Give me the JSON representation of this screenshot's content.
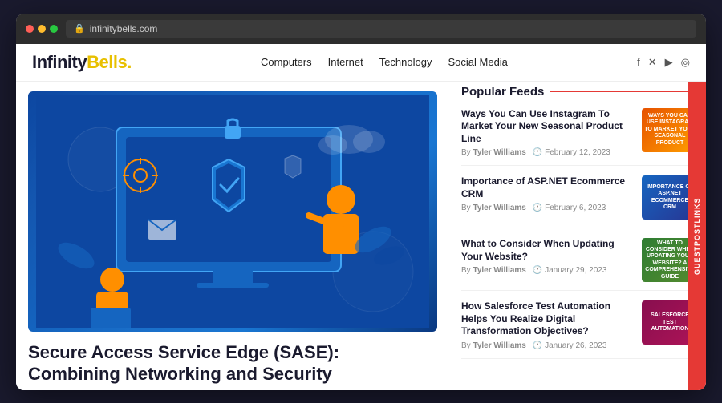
{
  "browser": {
    "url": "infinitybells.com",
    "dots": [
      "red",
      "yellow",
      "green"
    ]
  },
  "site": {
    "logo": {
      "part1": "Infinity",
      "part2": "Bells",
      "dot": "."
    },
    "nav": {
      "links": [
        "Computers",
        "Internet",
        "Technology",
        "Social Media"
      ]
    },
    "social_icons": [
      "f",
      "𝕏",
      "▶",
      "◉"
    ]
  },
  "sidebar": {
    "popular_feeds_title": "Popular Feeds",
    "feeds": [
      {
        "title": "Ways You Can Use Instagram To Market Your New Seasonal Product Line",
        "author": "Tyler Williams",
        "date": "February 12, 2023",
        "thumb_text": "WAYS YOU CAN USE INSTAGRAM TO MARKET YOUR SEASONAL PRODUCT"
      },
      {
        "title": "Importance of ASP.NET Ecommerce CRM",
        "author": "Tyler Williams",
        "date": "February 6, 2023",
        "thumb_text": "IMPORTANCE OF ASP.NET ECOMMERCE CRM"
      },
      {
        "title": "What to Consider When Updating Your Website?",
        "author": "Tyler Williams",
        "date": "January 29, 2023",
        "thumb_text": "WHAT TO CONSIDER WHEN UPDATING YOUR WEBSITE? A COMPREHENSIVE GUIDE"
      },
      {
        "title": "How Salesforce Test Automation Helps You Realize Digital Transformation Objectives?",
        "author": "Tyler Williams",
        "date": "January 26, 2023",
        "thumb_text": "SALESFORCE TEST AUTOMATION"
      }
    ]
  },
  "article": {
    "title_line1": "Secure Access Service Edge (SASE):",
    "title_line2": "Combining Networking and Security"
  },
  "guestpost": {
    "label": "GUESTPOSTLINKS"
  }
}
